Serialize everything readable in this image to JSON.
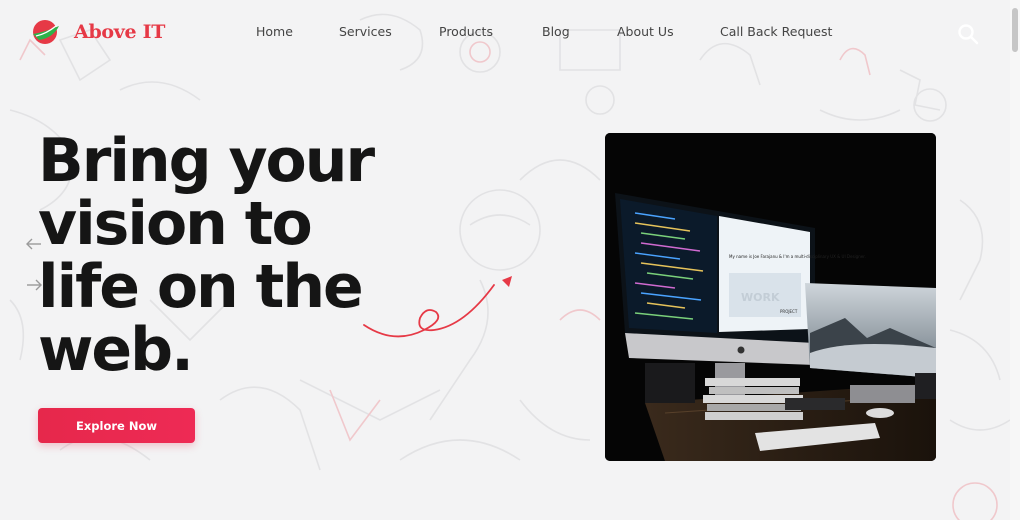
{
  "brand": {
    "name": "Above IT",
    "accent": "#e63946",
    "green": "#2db34a"
  },
  "nav": {
    "items": [
      "Home",
      "Services",
      "Products",
      "Blog",
      "About Us",
      "Call Back Request"
    ]
  },
  "icons": {
    "search": "search-icon",
    "prev": "arrow-left-icon",
    "next": "arrow-right-icon"
  },
  "hero": {
    "title_lines": [
      "Bring your",
      "vision to",
      "life on the",
      "web."
    ],
    "cta_label": "Explore Now",
    "cta_color": "#e6284b",
    "image_alt": "Desk with iMac showing code and a website",
    "monitor_text": "My name is Joe Farajanu & I'm a multi-disciplinary UX & UI Designer.",
    "monitor_word": "WORK",
    "monitor_project": "PROJECT"
  }
}
